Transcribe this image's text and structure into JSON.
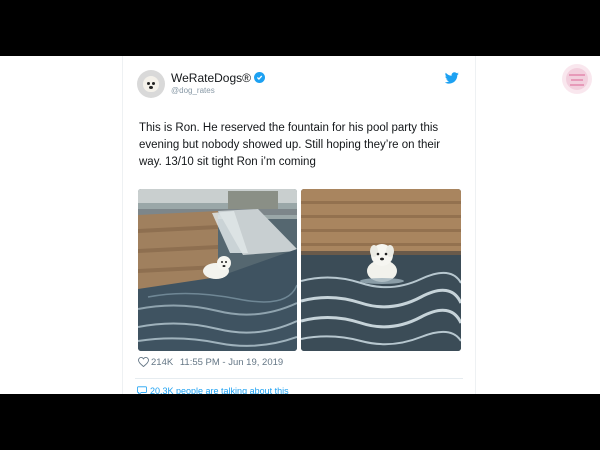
{
  "tweet": {
    "display_name": "WeRateDogs®",
    "handle": "@dog_rates",
    "text": "This is Ron. He reserved the fountain for his pool party this evening but nobody showed up. Still hoping they’re on their way. 13/10 sit tight Ron i’m coming",
    "likes": "214K",
    "timestamp": "11:55 PM - Jun 19, 2019",
    "footer_partial": "20.3K people are talking about this"
  },
  "icons": {
    "verified": "verified-badge-icon",
    "twitter": "twitter-bird-icon",
    "like": "heart-icon",
    "comment": "speech-bubble-icon"
  },
  "colors": {
    "accent": "#1da1f2",
    "text": "#14171a",
    "muted": "#657786",
    "letterbox": "#000000"
  }
}
